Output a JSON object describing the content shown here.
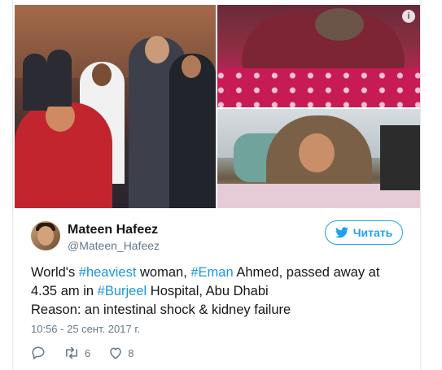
{
  "author": {
    "name": "Mateen Hafeez",
    "handle": "@Mateen_Hafeez"
  },
  "follow_button": {
    "label": "Читать"
  },
  "tweet": {
    "text_parts": [
      {
        "text": "World's ",
        "tag": false
      },
      {
        "text": "#heaviest",
        "tag": true
      },
      {
        "text": " woman, ",
        "tag": false
      },
      {
        "text": "#Eman",
        "tag": true
      },
      {
        "text": " Ahmed, passed away at 4.35 am in ",
        "tag": false
      },
      {
        "text": "#Burjeel",
        "tag": true
      },
      {
        "text": " Hospital, Abu Dhabi",
        "tag": false
      }
    ],
    "reason": "Reason: an intestinal shock & kidney failure",
    "timestamp": "10:56 - 25 сент. 2017 г."
  },
  "actions": {
    "retweets": "6",
    "likes": "8"
  },
  "media": {
    "info_icon": "i"
  },
  "colors": {
    "accent": "#1da1f2",
    "hashtag": "#1b95e0",
    "muted": "#657786",
    "text": "#14171a"
  },
  "icons": [
    "info-icon",
    "twitter-bird-icon",
    "reply-icon",
    "retweet-icon",
    "like-icon"
  ]
}
